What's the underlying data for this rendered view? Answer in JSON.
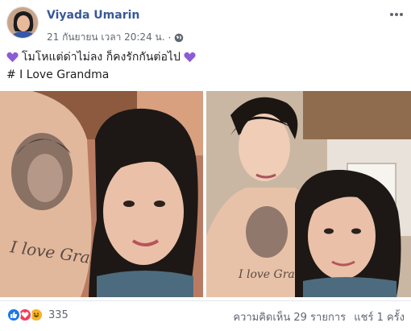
{
  "post": {
    "author": "Viyada Umarin",
    "timestamp": "21 กันยายน เวลา 20:24 น.",
    "separator": "·",
    "privacy_icon": "globe-icon",
    "menu_icon": "more-options-icon",
    "text_line1": "โมโหแต่ด่าไม่ลง ก็คงรักกันต่อไป",
    "text_line2": "# I Love Grandma",
    "emoji_icon": "purple-heart-icon"
  },
  "photos": {
    "left_tattoo_text": "I love Grandma",
    "right_tattoo_text": "I love Grandma"
  },
  "footer": {
    "reactions": [
      "like-icon",
      "love-icon",
      "haha-icon"
    ],
    "reaction_count": "335",
    "comments": "ความคิดเห็น 29 รายการ",
    "shares": "แชร์ 1 ครั้ง"
  },
  "colors": {
    "author": "#385898",
    "meta": "#606770",
    "heart": "#8c5bd6",
    "like": "#1877f2",
    "love": "#f33e58",
    "haha": "#f7b125"
  }
}
